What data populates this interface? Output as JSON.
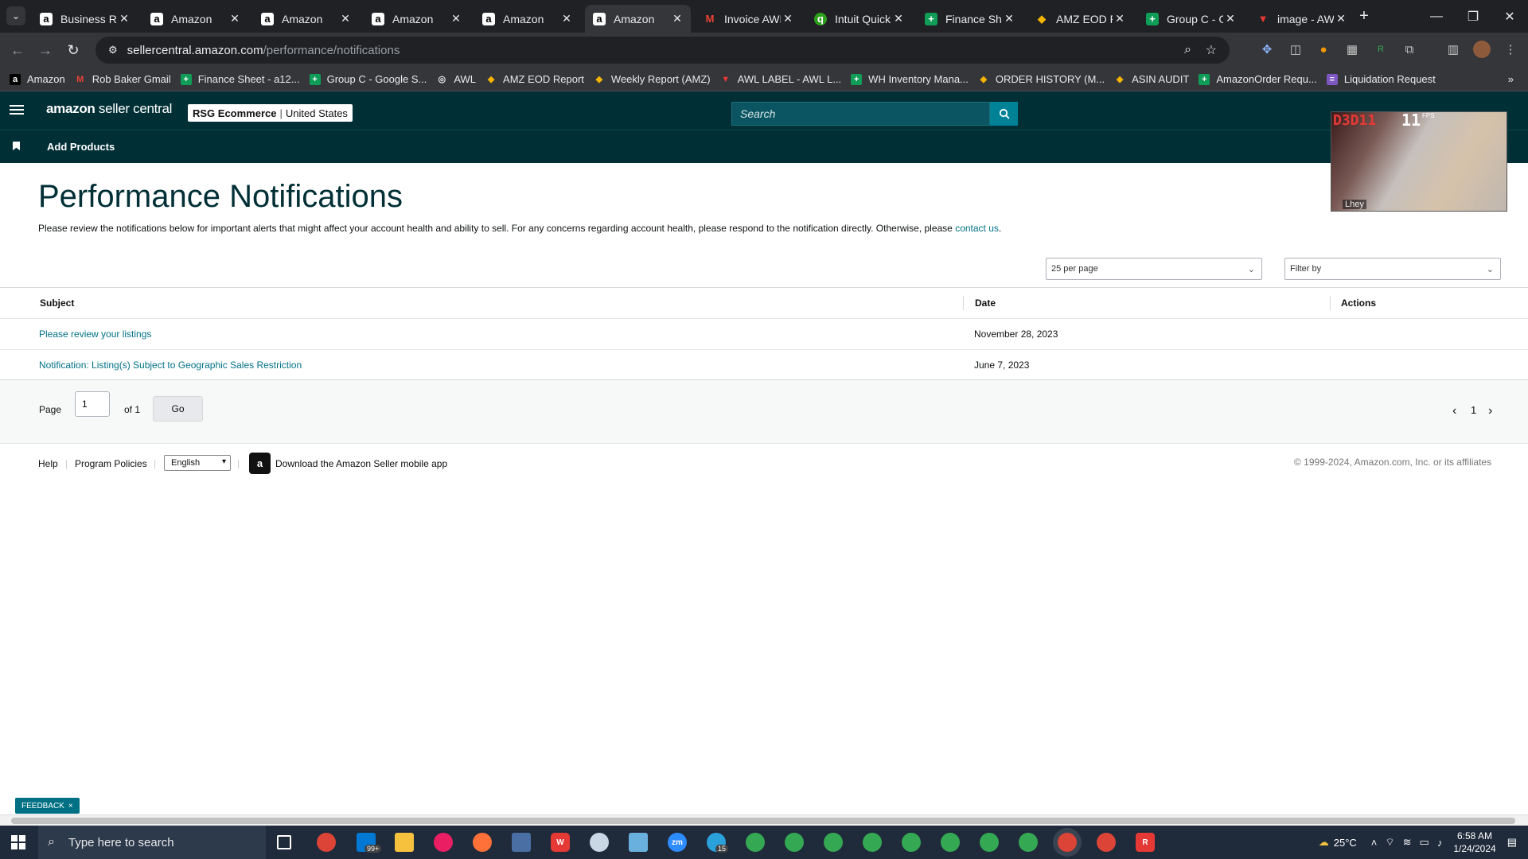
{
  "browser": {
    "tabs": [
      {
        "title": "Business Rep",
        "icon": "amazon-icon",
        "favtype": "fav-a",
        "fav": "a"
      },
      {
        "title": "Amazon",
        "icon": "amazon-icon",
        "favtype": "fav-a",
        "fav": "a"
      },
      {
        "title": "Amazon",
        "icon": "amazon-icon",
        "favtype": "fav-a",
        "fav": "a"
      },
      {
        "title": "Amazon",
        "icon": "amazon-icon",
        "favtype": "fav-a",
        "fav": "a"
      },
      {
        "title": "Amazon",
        "icon": "amazon-icon",
        "favtype": "fav-a",
        "fav": "a"
      },
      {
        "title": "Amazon",
        "icon": "amazon-icon",
        "favtype": "fav-a",
        "fav": "a",
        "active": true
      },
      {
        "title": "Invoice AWL",
        "icon": "gmail-icon",
        "favtype": "fav-m",
        "fav": "M"
      },
      {
        "title": "Intuit QuickB",
        "icon": "quickbooks-icon",
        "favtype": "fav-q",
        "fav": "q"
      },
      {
        "title": "Finance Shee",
        "icon": "sheets-icon",
        "favtype": "fav-s",
        "fav": "+"
      },
      {
        "title": "AMZ EOD Re",
        "icon": "chart-icon",
        "favtype": "fav-c",
        "fav": "◆"
      },
      {
        "title": "Group C - Go",
        "icon": "sheets-icon",
        "favtype": "fav-s",
        "fav": "+"
      },
      {
        "title": "image - AWL",
        "icon": "image-icon",
        "favtype": "fav-img",
        "fav": "▼"
      }
    ],
    "url_host": "sellercentral.amazon.com",
    "url_path": "/performance/notifications",
    "bookmarks": [
      {
        "label": "Amazon",
        "icon": "amazon-icon",
        "color": "#ffffff",
        "bg": "#000000",
        "glyph": "a"
      },
      {
        "label": "Rob Baker Gmail",
        "icon": "gmail-icon",
        "color": "#ea4335",
        "bg": "transparent",
        "glyph": "M"
      },
      {
        "label": "Finance Sheet - a12...",
        "icon": "sheets-icon",
        "color": "#ffffff",
        "bg": "#0f9d58",
        "glyph": "+"
      },
      {
        "label": "Group C - Google S...",
        "icon": "sheets-icon",
        "color": "#ffffff",
        "bg": "#0f9d58",
        "glyph": "+"
      },
      {
        "label": "AWL",
        "icon": "globe-icon",
        "color": "#e8eaed",
        "bg": "transparent",
        "glyph": "◎"
      },
      {
        "label": "AMZ EOD Report",
        "icon": "chart-icon",
        "color": "#f4b400",
        "bg": "transparent",
        "glyph": "◆"
      },
      {
        "label": "Weekly Report (AMZ)",
        "icon": "chart-icon",
        "color": "#f4b400",
        "bg": "transparent",
        "glyph": "◆"
      },
      {
        "label": "AWL LABEL - AWL L...",
        "icon": "label-icon",
        "color": "#e53935",
        "bg": "transparent",
        "glyph": "▼"
      },
      {
        "label": "WH Inventory Mana...",
        "icon": "sheets-icon",
        "color": "#ffffff",
        "bg": "#0f9d58",
        "glyph": "+"
      },
      {
        "label": "ORDER HISTORY (M...",
        "icon": "chart-icon",
        "color": "#f4b400",
        "bg": "transparent",
        "glyph": "◆"
      },
      {
        "label": "ASIN AUDIT",
        "icon": "chart-icon",
        "color": "#f4b400",
        "bg": "transparent",
        "glyph": "◆"
      },
      {
        "label": "AmazonOrder Requ...",
        "icon": "sheets-icon",
        "color": "#ffffff",
        "bg": "#0f9d58",
        "glyph": "+"
      },
      {
        "label": "Liquidation Request",
        "icon": "forms-icon",
        "color": "#ffffff",
        "bg": "#7e57c2",
        "glyph": "≡"
      }
    ]
  },
  "header": {
    "logo_bold": "amazon",
    "logo_rest": " seller central",
    "store_name": "RSG Ecommerce",
    "store_region": "United States",
    "search_placeholder": "Search",
    "add_products": "Add Products"
  },
  "page": {
    "title": "Performance Notifications",
    "description": "Please review the notifications below for important alerts that might affect your account health and ability to sell. For any concerns regarding account health, please respond to the notification directly. Otherwise, please ",
    "contact_link": "contact us",
    "description_end": ".",
    "per_page": "25 per page",
    "filter_by": "Filter by",
    "columns": {
      "subject": "Subject",
      "date": "Date",
      "actions": "Actions"
    },
    "rows": [
      {
        "subject": "Please review your listings",
        "date": "November 28, 2023"
      },
      {
        "subject": "Notification: Listing(s) Subject to Geographic Sales Restriction",
        "date": "June 7, 2023"
      }
    ],
    "pager": {
      "page_label": "Page",
      "page_value": "1",
      "of_label": "of 1",
      "go": "Go",
      "current": "1"
    }
  },
  "footer": {
    "help": "Help",
    "program_policies": "Program Policies",
    "language": "English",
    "app_download": "Download the Amazon Seller mobile app",
    "copyright": "© 1999-2024, Amazon.com, Inc. or its affiliates"
  },
  "feedback": "FEEDBACK",
  "overlay": {
    "app": "D3D11",
    "fps": "11",
    "fps_label": "FPS",
    "name": "Lhey"
  },
  "taskbar": {
    "search_placeholder": "Type here to search",
    "mail_badge": "99+",
    "telegram_badge": "15",
    "temperature": "25°C",
    "time": "6:58 AM",
    "date": "1/24/2024"
  },
  "colors": {
    "header_bg": "#002f36",
    "link": "#007185",
    "search_btn": "#008296"
  }
}
